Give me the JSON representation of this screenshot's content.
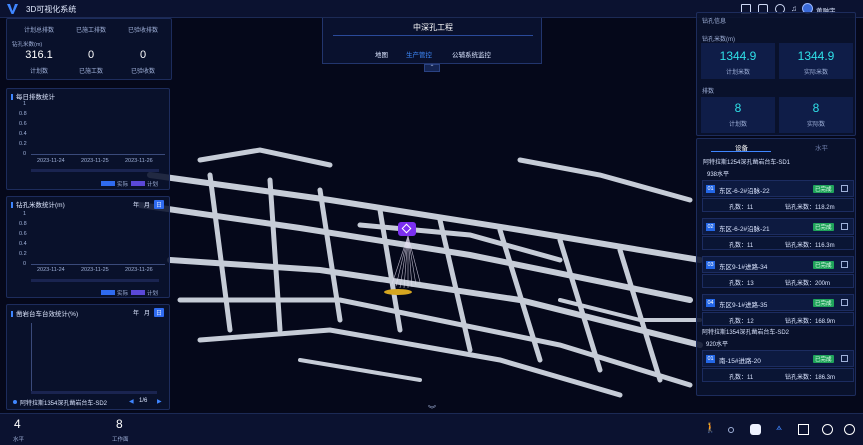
{
  "app": {
    "title": "3D可视化系统",
    "user": "黄翀宇"
  },
  "header": {
    "project": "中深孔工程",
    "tabs": [
      "地图",
      "生产管控",
      "公辅系统监控"
    ],
    "active_tab": 1,
    "collapse_glyph": "⌃"
  },
  "left": {
    "plan": {
      "headers": [
        "计划总排数",
        "已施工排数",
        "已验收排数"
      ],
      "sub": "钻孔米数(m)",
      "values": [
        "316.1",
        "0",
        "0"
      ],
      "labels": [
        "计划数",
        "已施工数",
        "已验收数"
      ]
    },
    "daily": {
      "title": "每日排数统计",
      "yticks": [
        "1",
        "0.8",
        "0.6",
        "0.4",
        "0.2",
        "0"
      ],
      "xticks": [
        "2023-11-24",
        "2023-11-25",
        "2023-11-26"
      ],
      "legend": [
        "实际",
        "计划"
      ]
    },
    "meters": {
      "title": "钻孔米数统计(m)",
      "periods": [
        "年",
        "月",
        "日"
      ],
      "yticks": [
        "1",
        "0.8",
        "0.6",
        "0.4",
        "0.2",
        "0"
      ],
      "xticks": [
        "2023-11-24",
        "2023-11-25",
        "2023-11-26"
      ],
      "legend": [
        "实际",
        "计划"
      ]
    },
    "efficiency": {
      "title": "凿岩台车台效统计(%)",
      "periods": [
        "年",
        "月",
        "日"
      ],
      "device": "阿特拉斯1354深孔凿岩台车-SD2",
      "page": "1/6"
    }
  },
  "right": {
    "drill": {
      "title": "钻孔信息",
      "sub": "钻孔米数(m)",
      "plan": "1344.9",
      "actual": "1344.9",
      "plan_label": "计划米数",
      "actual_label": "实际米数"
    },
    "rows": {
      "sub": "排数",
      "plan": "8",
      "actual": "8",
      "plan_label": "计划数",
      "actual_label": "实际数"
    },
    "tabs": [
      "设备",
      "水平"
    ],
    "groups": [
      {
        "device": "阿特拉斯1254深孔凿岩台车-SD1",
        "level": "938水平",
        "items": [
          {
            "no": "01",
            "name": "东区-6-2#沿脉-22",
            "status": "已完成",
            "holes": "孔数：11",
            "meters": "钻孔米数：118.2m"
          },
          {
            "no": "02",
            "name": "东区-6-2#沿脉-21",
            "status": "已完成",
            "holes": "孔数：11",
            "meters": "钻孔米数：116.3m"
          },
          {
            "no": "03",
            "name": "东区9-1#进路-34",
            "status": "已完成",
            "holes": "孔数：13",
            "meters": "钻孔米数：200m"
          },
          {
            "no": "04",
            "name": "东区9-1#进路-35",
            "status": "已完成",
            "holes": "孔数：12",
            "meters": "钻孔米数：168.9m"
          }
        ]
      },
      {
        "device": "阿特拉斯1354深孔凿岩台车-SD2",
        "level": "920水平",
        "items": [
          {
            "no": "01",
            "name": "南-15#进路-20",
            "status": "已完成",
            "holes": "孔数：11",
            "meters": "钻孔米数：186.3m"
          }
        ]
      }
    ]
  },
  "bottom": {
    "levels_count": "4",
    "levels_label": "水平",
    "faces_count": "8",
    "faces_label": "工作面",
    "tools": [
      "walk-icon",
      "dot-icon",
      "settings-hex-icon",
      "compass-icon",
      "fullscreen-icon",
      "target-icon",
      "globe-icon"
    ]
  },
  "colors": {
    "accent": "#2f6bf0",
    "cyan": "#2fe0e8",
    "success": "#1fa35a",
    "marker": "#7b2ff0"
  }
}
